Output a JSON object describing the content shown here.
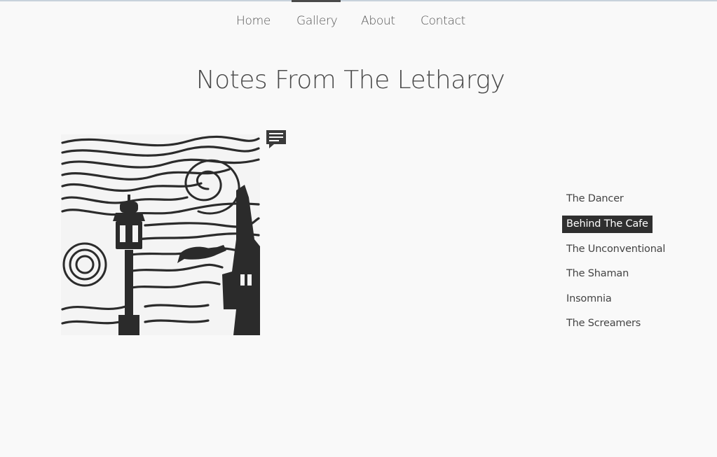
{
  "nav": {
    "items": [
      {
        "label": "Home"
      },
      {
        "label": "Gallery"
      },
      {
        "label": "About"
      },
      {
        "label": "Contact"
      }
    ],
    "active": "Gallery"
  },
  "page": {
    "title": "Notes From The Lethargy"
  },
  "artwork": {
    "icon": "comment-icon"
  },
  "gallery_list": {
    "items": [
      {
        "label": "The Dancer"
      },
      {
        "label": "Behind The Cafe"
      },
      {
        "label": "The Unconventional"
      },
      {
        "label": "The Shaman"
      },
      {
        "label": "Insomnia"
      },
      {
        "label": "The Screamers"
      }
    ],
    "active": "Behind The Cafe"
  },
  "colors": {
    "background": "#f9f9f9",
    "text": "#3a3a3a",
    "active_item_bg": "#2f2f2f",
    "active_item_text": "#ffffff",
    "ink": "#2b2b2b"
  }
}
